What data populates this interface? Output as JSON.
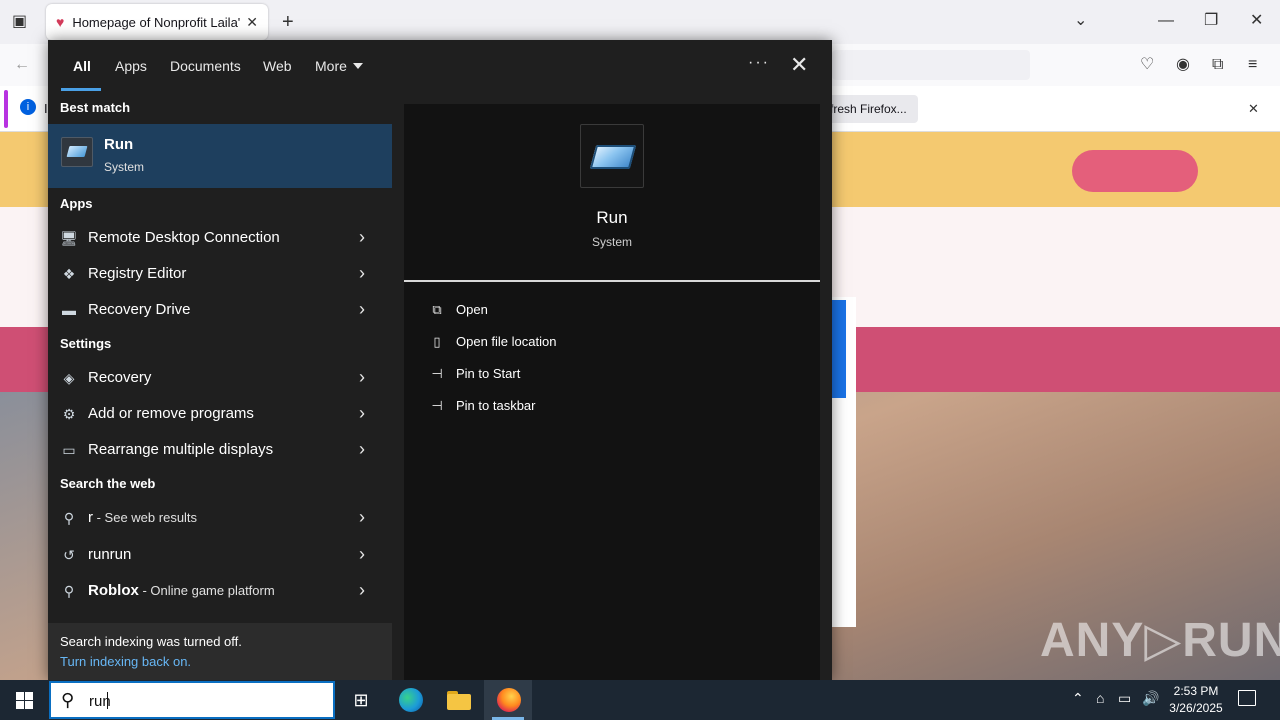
{
  "browser": {
    "tab_title": "Homepage of Nonprofit Laila's",
    "tab_close": "✕",
    "new_tab": "+",
    "refresh_button": "fresh Firefox...",
    "notif_close": "✕",
    "notif_info": "i",
    "notif_text": "I"
  },
  "search": {
    "tabs": [
      {
        "label": "All"
      },
      {
        "label": "Apps"
      },
      {
        "label": "Documents"
      },
      {
        "label": "Web"
      },
      {
        "label": "More"
      }
    ],
    "more_options": "···",
    "close": "✕",
    "best_match": {
      "heading": "Best match",
      "title": "Run",
      "subtitle": "System"
    },
    "apps": {
      "heading": "Apps",
      "items": [
        {
          "label": "Remote Desktop Connection",
          "icon": "remote-desktop-icon"
        },
        {
          "label": "Registry Editor",
          "icon": "registry-editor-icon"
        },
        {
          "label": "Recovery Drive",
          "icon": "recovery-drive-icon"
        }
      ]
    },
    "settings": {
      "heading": "Settings",
      "items": [
        {
          "label": "Recovery",
          "icon": "recovery-icon"
        },
        {
          "label": "Add or remove programs",
          "icon": "gear-icon"
        },
        {
          "label": "Rearrange multiple displays",
          "icon": "display-icon"
        }
      ]
    },
    "web": {
      "heading": "Search the web",
      "items": [
        {
          "main": "r",
          "sub": " - See web results",
          "icon": "search-icon"
        },
        {
          "main": "runrun",
          "sub": "",
          "icon": "history-icon"
        },
        {
          "main": "Roblox",
          "sub": " - Online game platform",
          "icon": "search-icon"
        }
      ]
    },
    "indexing": {
      "message": "Search indexing was turned off.",
      "link": "Turn indexing back on."
    },
    "preview": {
      "title": "Run",
      "subtitle": "System",
      "actions": [
        {
          "label": "Open",
          "icon": "open-icon"
        },
        {
          "label": "Open file location",
          "icon": "file-location-icon"
        },
        {
          "label": "Pin to Start",
          "icon": "pin-icon"
        },
        {
          "label": "Pin to taskbar",
          "icon": "pin-icon"
        }
      ]
    }
  },
  "taskbar": {
    "search_value": "run",
    "time": "2:53 PM",
    "date": "3/26/2025"
  },
  "watermark": "ANY▷RUN",
  "colors": {
    "accent": "#4aa0e6",
    "best_match_bg": "#1e3f5e",
    "link": "#67b7f5"
  }
}
